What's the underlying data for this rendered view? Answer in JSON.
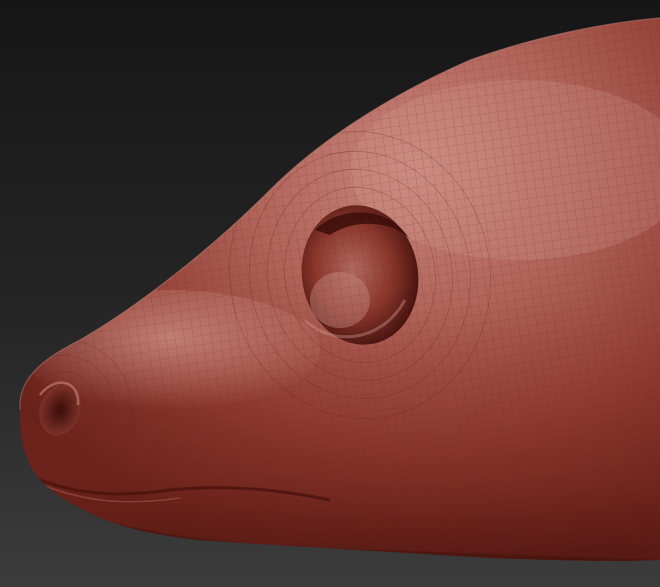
{
  "scene": {
    "background_top": "#171717",
    "background_bottom": "#3a3a3a",
    "clay_light": "#c98a80",
    "clay_mid": "#a0433a",
    "clay_dark": "#5b1812",
    "clay_shadow": "#3d0e0a",
    "wire_color": "#7a2a22"
  }
}
